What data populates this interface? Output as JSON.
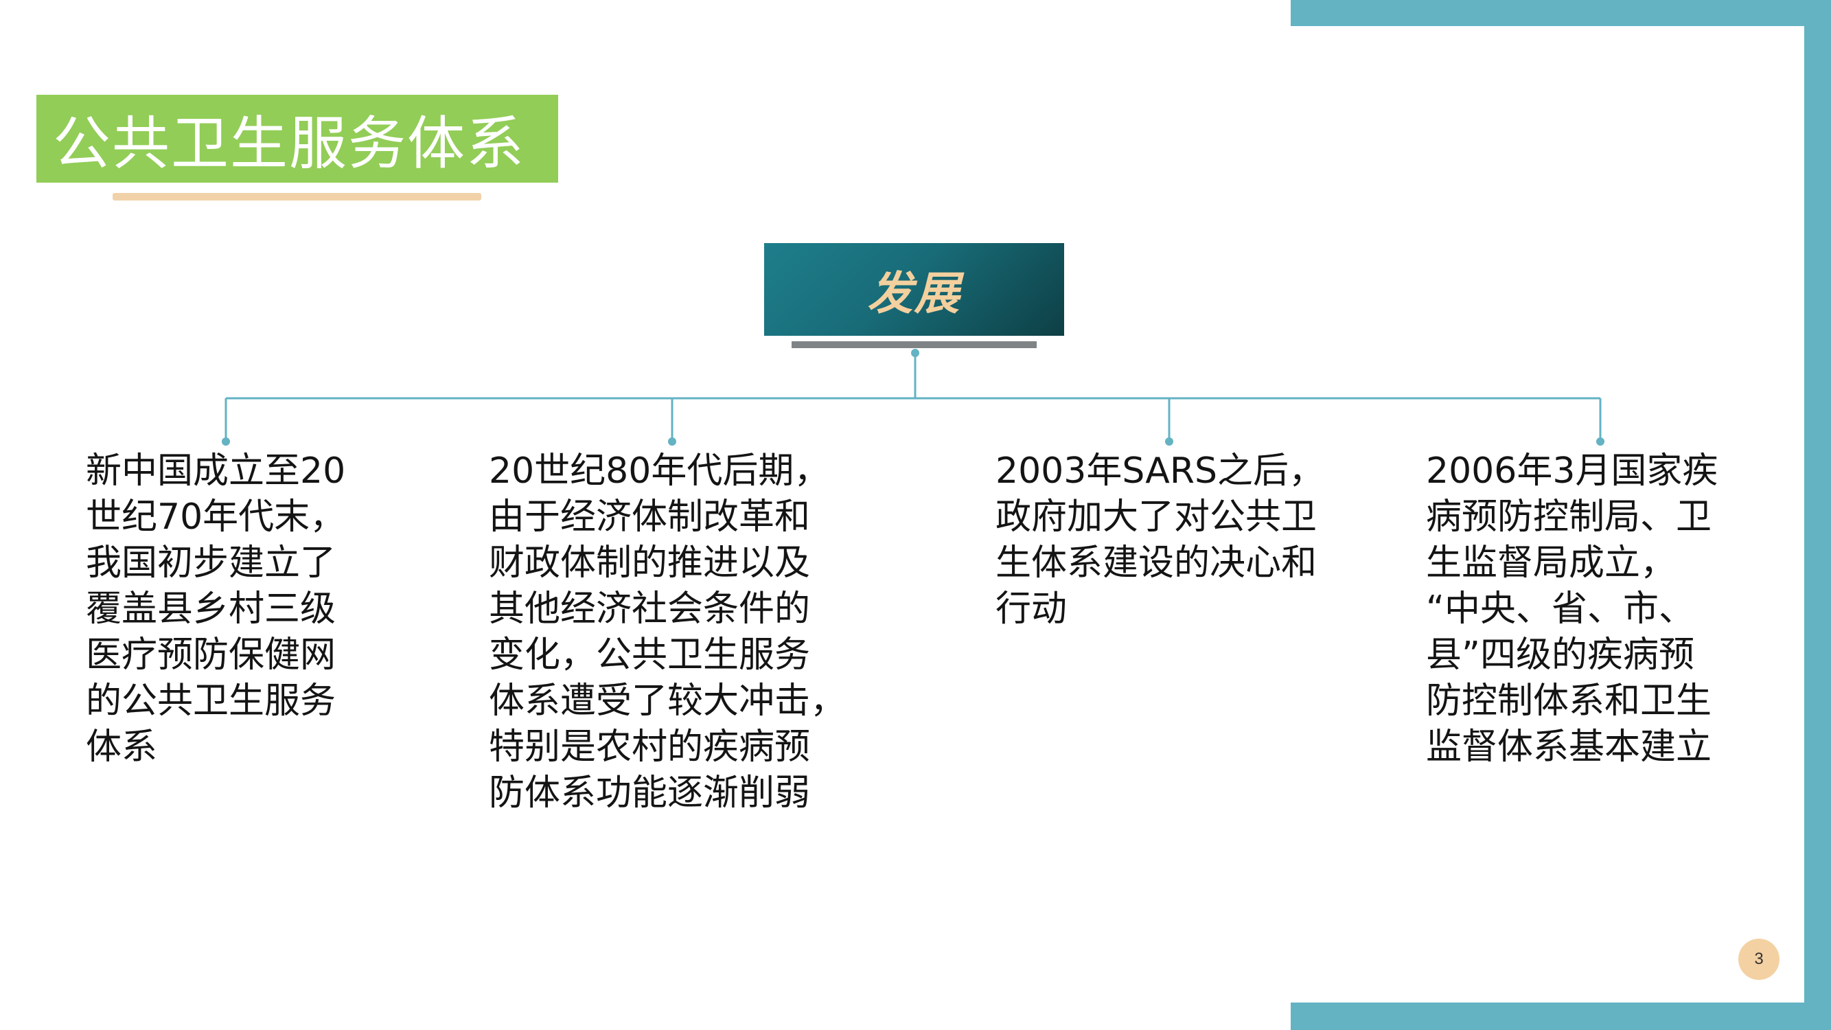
{
  "title": "公共卫生服务体系",
  "center_node": "发展",
  "branches": [
    {
      "lines": [
        "新中国成立至20",
        "世纪70年代末，",
        "我国初步建立了",
        "覆盖县乡村三级",
        "医疗预防保健网",
        "的公共卫生服务",
        "体系"
      ]
    },
    {
      "lines": [
        "20世纪80年代后期，",
        "由于经济体制改革和",
        "财政体制的推进以及",
        "其他经济社会条件的",
        "变化，公共卫生服务",
        "体系遭受了较大冲击，",
        "特别是农村的疾病预",
        "防体系功能逐渐削弱"
      ]
    },
    {
      "lines": [
        "2003年SARS之后，",
        "政府加大了对公共卫",
        "生体系建设的决心和",
        "行动"
      ]
    },
    {
      "lines": [
        "2006年3月国家疾",
        "病预防控制局、卫",
        "生监督局成立，",
        "“中央、省、市、",
        "县”四级的疾病预",
        "防控制体系和卫生",
        "监督体系基本建立"
      ]
    }
  ],
  "page_number": "3",
  "colors": {
    "frame": "#63B3C3",
    "title_bg": "#92CD57",
    "title_underline": "#F1D2A8",
    "node_bg": "#186C78",
    "node_text": "#F3D09E",
    "connector": "#63B3C3",
    "page_badge": "#F4D1A2"
  }
}
